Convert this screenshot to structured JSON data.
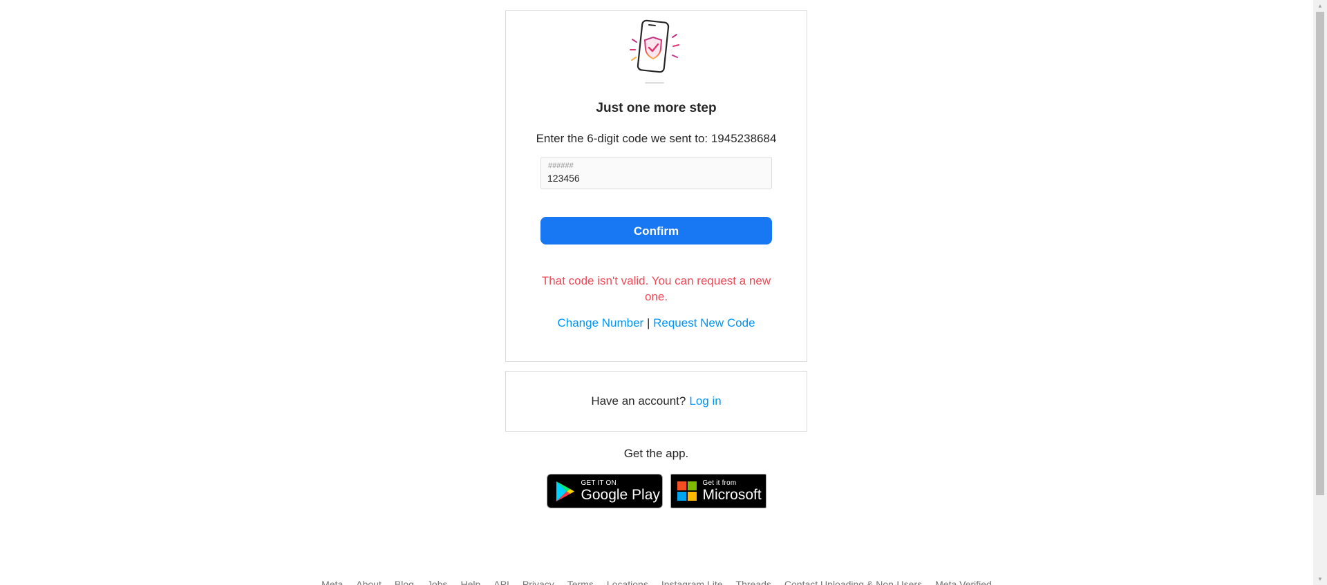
{
  "verify": {
    "title": "Just one more step",
    "instruction": "Enter the 6-digit code we sent to: 1945238684",
    "code_placeholder": "######",
    "code_value": "123456",
    "confirm_label": "Confirm",
    "error": "That code isn't valid. You can request a new one.",
    "change_number": "Change Number",
    "separator": "|",
    "request_code": "Request New Code"
  },
  "account": {
    "prompt": "Have an account?",
    "login_label": "Log in"
  },
  "app": {
    "heading": "Get the app.",
    "google_small": "GET IT ON",
    "google_big": "Google Play",
    "microsoft_small": "Get it from",
    "microsoft_big": "Microsoft"
  },
  "footer": {
    "links": [
      "Meta",
      "About",
      "Blog",
      "Jobs",
      "Help",
      "API",
      "Privacy",
      "Terms",
      "Locations",
      "Instagram Lite",
      "Threads",
      "Contact Uploading & Non-Users",
      "Meta Verified"
    ]
  },
  "colors": {
    "primary_button": "#1877f2",
    "link": "#0095f6",
    "error": "#ed4956",
    "border": "#dbdbdb"
  },
  "icons": {
    "illustration": "phone-shield-check-icon",
    "google_play": "google-play-icon",
    "microsoft": "microsoft-logo-icon"
  }
}
